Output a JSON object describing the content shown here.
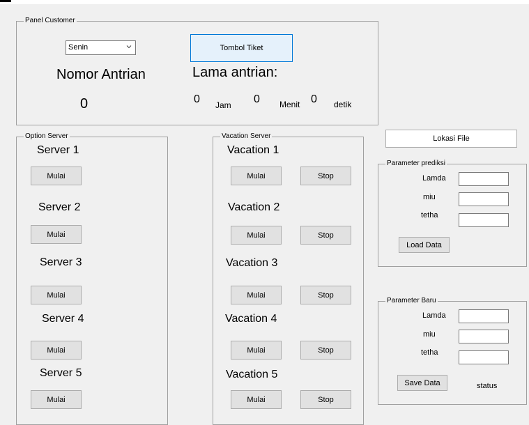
{
  "customer_panel": {
    "legend": "Panel Customer",
    "day_select": "Senin",
    "ticket_button": "Tombol Tiket",
    "queue_number_label": "Nomor Antrian",
    "queue_number_value": "0",
    "wait_label": "Lama antrian:",
    "hours_value": "0",
    "hours_unit": "Jam",
    "minutes_value": "0",
    "minutes_unit": "Menit",
    "seconds_value": "0",
    "seconds_unit": "detik"
  },
  "option_server": {
    "legend": "Option Server",
    "servers": [
      {
        "label": "Server 1",
        "start": "Mulai"
      },
      {
        "label": "Server 2",
        "start": "Mulai"
      },
      {
        "label": "Server 3",
        "start": "Mulai"
      },
      {
        "label": "Server 4",
        "start": "Mulai"
      },
      {
        "label": "Server 5",
        "start": "Mulai"
      }
    ]
  },
  "vacation_server": {
    "legend": "Vacation Server",
    "vacations": [
      {
        "label": "Vacation 1",
        "start": "Mulai",
        "stop": "Stop"
      },
      {
        "label": "Vacation 2",
        "start": "Mulai",
        "stop": "Stop"
      },
      {
        "label": "Vacation 3",
        "start": "Mulai",
        "stop": "Stop"
      },
      {
        "label": "Vacation 4",
        "start": "Mulai",
        "stop": "Stop"
      },
      {
        "label": "Vacation 5",
        "start": "Mulai",
        "stop": "Stop"
      }
    ]
  },
  "file_button": "Lokasi File",
  "prediction_params": {
    "legend": "Parameter prediksi",
    "lamda_label": "Lamda",
    "miu_label": "miu",
    "tetha_label": "tetha",
    "load_button": "Load Data"
  },
  "new_params": {
    "legend": "Parameter Baru",
    "lamda_label": "Lamda",
    "miu_label": "miu",
    "tetha_label": "tetha",
    "save_button": "Save Data",
    "status": "status"
  }
}
